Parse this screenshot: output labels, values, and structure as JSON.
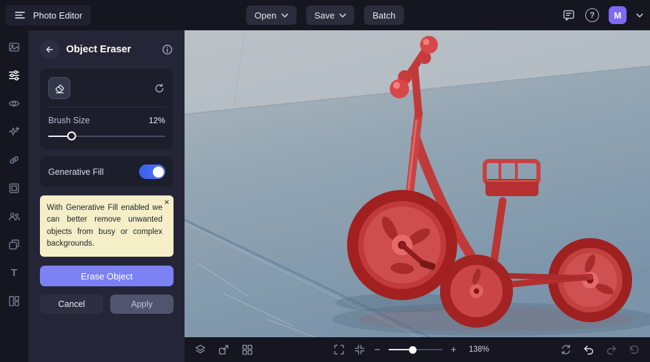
{
  "header": {
    "app_title": "Photo Editor",
    "open_label": "Open",
    "save_label": "Save",
    "batch_label": "Batch",
    "help_glyph": "?",
    "avatar_initial": "M"
  },
  "sidebar": {
    "text_tool_glyph": "T"
  },
  "panel": {
    "title": "Object Eraser",
    "brush_size_label": "Brush Size",
    "brush_size_value": "12%",
    "generative_fill_label": "Generative Fill",
    "generative_fill_enabled": true,
    "tooltip_text": "With Generative Fill enabled we can better remove unwanted objects from busy or complex backgrounds.",
    "tooltip_close": "×",
    "erase_button": "Erase Object",
    "cancel_button": "Cancel",
    "apply_button": "Apply"
  },
  "footer": {
    "zoom_out_glyph": "−",
    "zoom_in_glyph": "+",
    "zoom_value": "138%"
  },
  "colors": {
    "accent": "#7c82f4",
    "toggle_on": "#4a6cf3",
    "tooltip_bg": "#f4efc6",
    "mask_red": "#d94343",
    "avatar_purple": "#7e6bf3",
    "canvas_concrete": "#8fa2b2"
  }
}
